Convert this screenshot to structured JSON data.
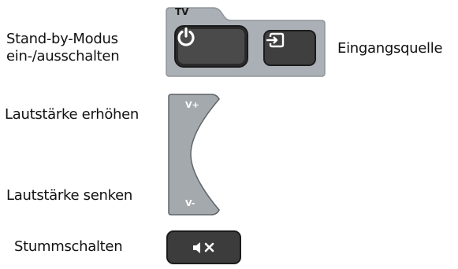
{
  "labels": {
    "standby_line1": "Stand-by-Modus",
    "standby_line2": "ein-/ausschalten",
    "input_source": "Eingangsquelle",
    "volume_up": "Lautstärke erhöhen",
    "volume_down": "Lautstärke senken",
    "mute": "Stummschalten"
  },
  "tv_panel": {
    "title": "TV",
    "buttons": [
      {
        "name": "power",
        "icon": "power-icon"
      },
      {
        "name": "input",
        "icon": "input-source-icon"
      }
    ]
  },
  "volume_rocker": {
    "up_label": "V+",
    "down_label": "V-"
  },
  "mute_button": {
    "icon": "speaker-mute-icon"
  },
  "colors": {
    "panel": "#aab0b6",
    "button_dark": "#3f3f3f",
    "button_border": "#1c1c1c",
    "rocker": "#a4a9ad"
  }
}
